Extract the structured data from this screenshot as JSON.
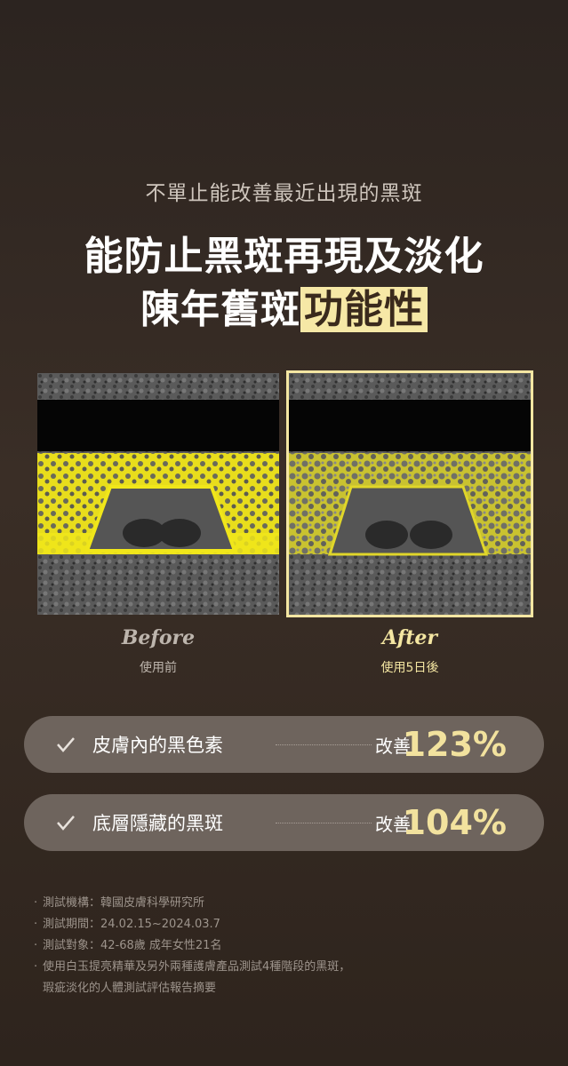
{
  "header": {
    "subtitle": "不單止能改善最近出現的黑斑",
    "headline_line1": "能防止黑斑再現及淡化",
    "headline_line2_plain": "陳年舊斑",
    "headline_line2_highlight": "功能性"
  },
  "comparison": {
    "before": {
      "label": "Before",
      "sublabel": "使用前"
    },
    "after": {
      "label": "After",
      "sublabel": "使用5日後"
    }
  },
  "stats": [
    {
      "label": "皮膚內的黑色素",
      "improve_label": "改善",
      "value": "123%"
    },
    {
      "label": "底層隱藏的黑斑",
      "improve_label": "改善",
      "value": "104%"
    }
  ],
  "notes": [
    "測試機構：韓國皮膚科學研究所",
    "測試期間：24.02.15~2024.03.7",
    "測試對象：42-68歲 成年女性21名",
    "使用白玉提亮精華及另外兩種護膚產品測試4種階段的黑斑，",
    "瑕疵淡化的人體測試評估報告摘要"
  ],
  "colors": {
    "accent": "#f2e29e",
    "highlight_bg": "#f6e8a6",
    "pill_bg": "#6e645d",
    "melanin_yellow": "#f0e61a"
  }
}
